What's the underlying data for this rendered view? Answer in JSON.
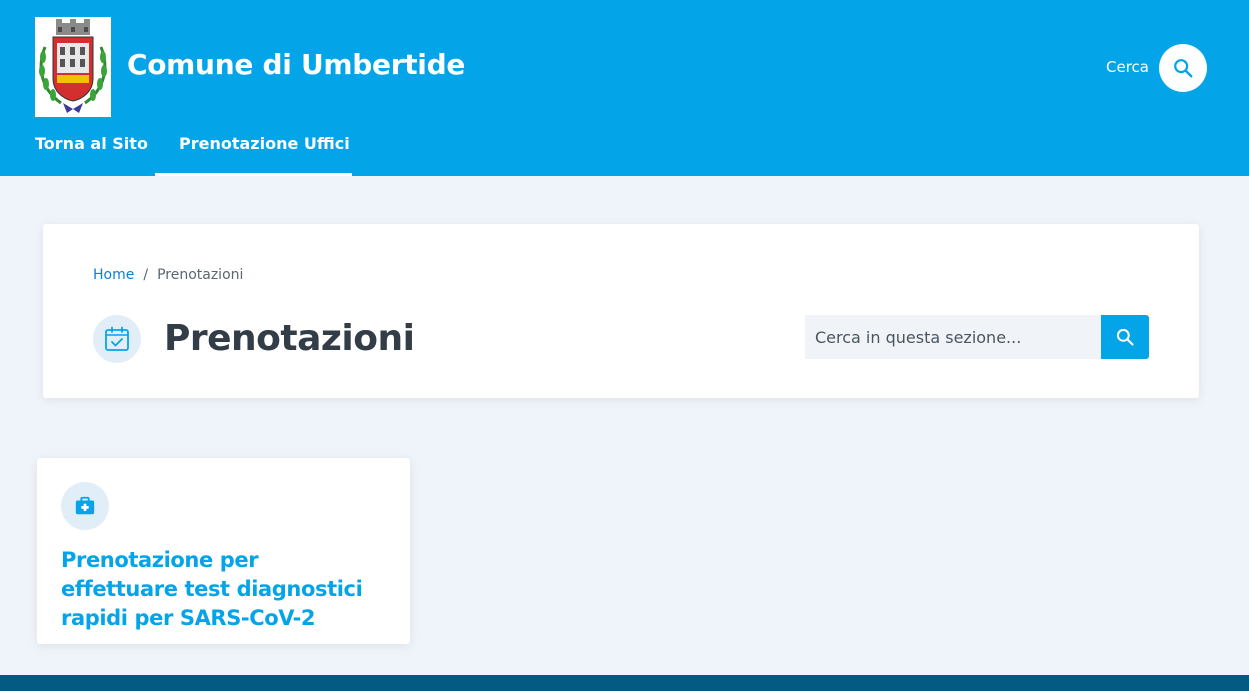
{
  "header": {
    "site_title": "Comune di Umbertide",
    "search_label": "Cerca",
    "logo_icon": "municipal-coat-of-arms-icon",
    "nav": [
      {
        "label": "Torna al Sito",
        "active": false
      },
      {
        "label": "Prenotazione Uffici",
        "active": true
      }
    ]
  },
  "breadcrumb": {
    "home": "Home",
    "separator": "/",
    "current": "Prenotazioni"
  },
  "page": {
    "title": "Prenotazioni",
    "title_icon": "calendar-check-icon",
    "search_placeholder": "Cerca in questa sezione..."
  },
  "services": [
    {
      "title": "Prenotazione per effettuare test diagnostici rapidi per SARS-CoV-2",
      "icon": "medical-kit-icon"
    }
  ],
  "colors": {
    "header_bg": "#04a4e9",
    "page_bg": "#eef4f9",
    "footer_bg": "#035b84",
    "link": "#0b7fd3",
    "title_text": "#333d47"
  }
}
